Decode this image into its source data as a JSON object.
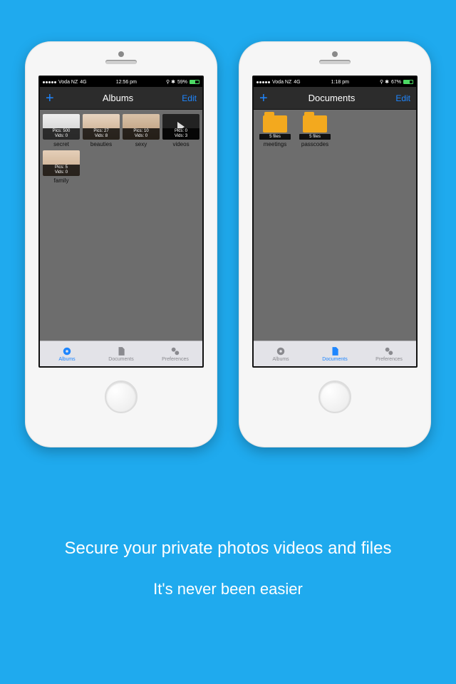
{
  "caption": {
    "line1": "Secure your private photos videos and files",
    "line2": "It's never been easier"
  },
  "tabs": {
    "albums": "Albums",
    "documents": "Documents",
    "preferences": "Preferences"
  },
  "nav": {
    "edit": "Edit",
    "plus": "+"
  },
  "phone1": {
    "status": {
      "carrier": "Voda NZ",
      "net": "4G",
      "time": "12:56 pm",
      "battery": "59%"
    },
    "title": "Albums",
    "items": [
      {
        "name": "secret",
        "pics": "Pics: 500",
        "vids": "Vids: 0",
        "type": "photo"
      },
      {
        "name": "beauties",
        "pics": "Pics: 27",
        "vids": "Vids: 8",
        "type": "photo"
      },
      {
        "name": "sexy",
        "pics": "Pics: 10",
        "vids": "Vids: 0",
        "type": "photo"
      },
      {
        "name": "videos",
        "pics": "Pics: 0",
        "vids": "Vids: 3",
        "type": "video"
      },
      {
        "name": "family",
        "pics": "Pics: 5",
        "vids": "Vids: 0",
        "type": "photo"
      }
    ]
  },
  "phone2": {
    "status": {
      "carrier": "Voda NZ",
      "net": "4G",
      "time": "1:18 pm",
      "battery": "67%"
    },
    "title": "Documents",
    "items": [
      {
        "name": "meetings",
        "files": "5 files"
      },
      {
        "name": "passcodes",
        "files": "5 files"
      }
    ]
  }
}
